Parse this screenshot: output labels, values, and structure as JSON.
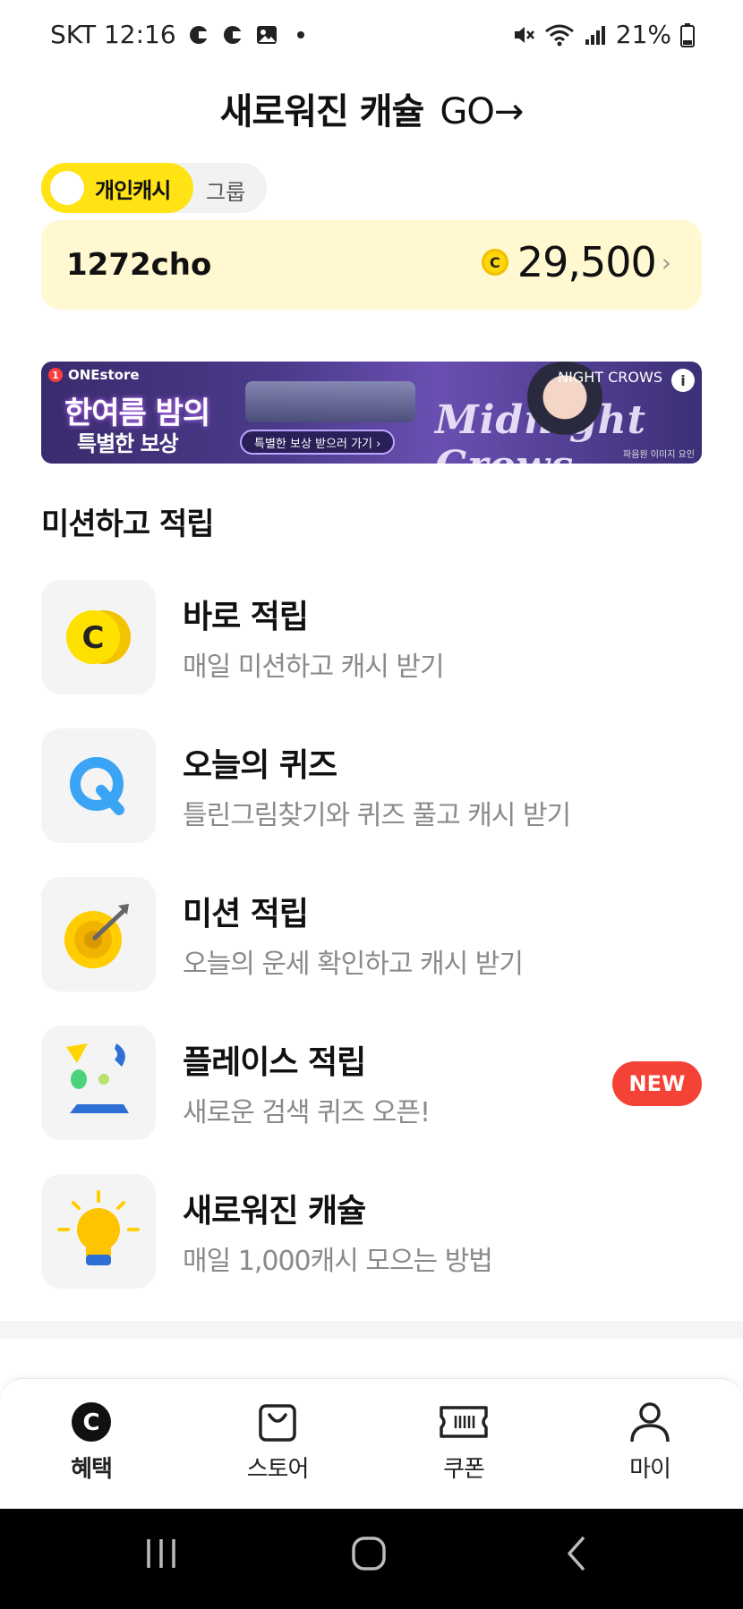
{
  "status_bar": {
    "carrier_time": "SKT 12:16",
    "battery": "21%",
    "icons": [
      "notification-icon",
      "notification-icon",
      "gallery-icon",
      "dot-icon",
      "mute-icon",
      "wifi-icon",
      "signal-icon",
      "battery-icon"
    ]
  },
  "header": {
    "title": "새로워진 캐슐",
    "go": "GO→"
  },
  "toggle": {
    "active_label": "개인캐시",
    "inactive_label": "그룹"
  },
  "cash": {
    "user": "1272cho",
    "coin_symbol": "C",
    "amount": "29,500",
    "chevron": "›"
  },
  "banner": {
    "store": "ONEstore",
    "store_badge": "1",
    "headline": "한여름 밤의",
    "subline": "특별한 보상",
    "cta": "특별한 보상 받으러 가기 ›",
    "brand": "NIGHT CROWS",
    "logo": "Midnight Crows",
    "info": "i",
    "note": "파음원 이미지 요인"
  },
  "section": {
    "title": "미션하고 적립"
  },
  "missions": [
    {
      "title": "바로 적립",
      "desc": "매일 미션하고 캐시 받기",
      "icon": "coin-icon",
      "badge": ""
    },
    {
      "title": "오늘의 퀴즈",
      "desc": "틀린그림찾기와 퀴즈 풀고 캐시 받기",
      "icon": "quiz-icon",
      "badge": ""
    },
    {
      "title": "미션 적립",
      "desc": "오늘의 운세 확인하고 캐시 받기",
      "icon": "target-icon",
      "badge": ""
    },
    {
      "title": "플레이스 적립",
      "desc": "새로운 검색 퀴즈 오픈!",
      "icon": "place-icon",
      "badge": "NEW"
    },
    {
      "title": "새로워진 캐슐",
      "desc": "매일 1,000캐시 모으는 방법",
      "icon": "lightbulb-icon",
      "badge": ""
    }
  ],
  "bottom_nav": [
    {
      "label": "혜택",
      "icon": "benefit-icon",
      "active": true
    },
    {
      "label": "스토어",
      "icon": "store-bag-icon",
      "active": false
    },
    {
      "label": "쿠폰",
      "icon": "coupon-icon",
      "active": false
    },
    {
      "label": "마이",
      "icon": "person-icon",
      "active": false
    }
  ],
  "colors": {
    "accent_yellow": "#ffe314",
    "card_bg": "#fff8d1",
    "new_badge": "#f44336",
    "quiz_blue": "#3ba4f5"
  }
}
